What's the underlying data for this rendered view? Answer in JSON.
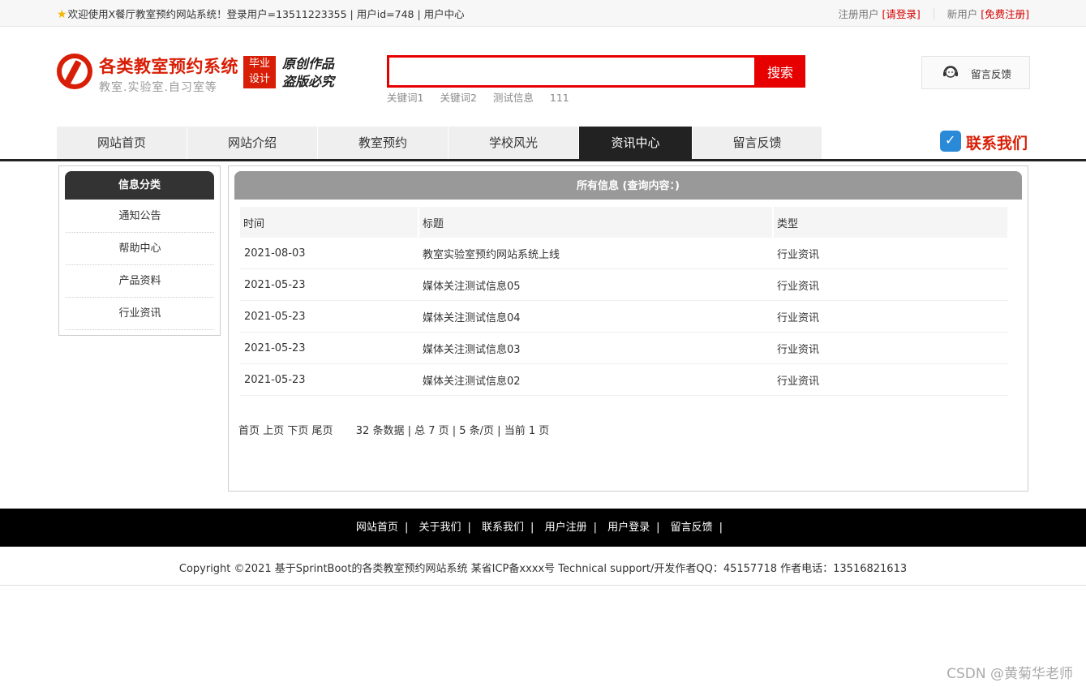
{
  "topbar": {
    "welcome": "欢迎使用X餐厅教室预约网站系统！登录用户=13511223355 | 用户id=748 | 用户中心",
    "reg_user_label": "注册用户",
    "login_link": "[请登录]",
    "new_user_label": "新用户",
    "register_link": "[免费注册]"
  },
  "logo": {
    "title": "各类教室预约系统",
    "subtitle": "教室.实验室.自习室等",
    "badge_line1": "毕业",
    "badge_line2": "设计",
    "seal_line1": "原创作品",
    "seal_line2": "盗版必究",
    "brand_color": "#d81e06"
  },
  "search": {
    "value": "",
    "placeholder": "",
    "button_label": "搜索",
    "hotwords": [
      "关键词1",
      "关键词2",
      "测试信息",
      "111"
    ]
  },
  "feedback_box": {
    "label": "留言反馈",
    "icon": "headset-icon"
  },
  "nav": {
    "items": [
      {
        "label": "网站首页"
      },
      {
        "label": "网站介绍"
      },
      {
        "label": "教室预约"
      },
      {
        "label": "学校风光"
      },
      {
        "label": "资讯中心",
        "active": true
      },
      {
        "label": "留言反馈"
      }
    ],
    "contact_label": "联系我们",
    "contact_icon": "phone-check-icon"
  },
  "sidebar": {
    "title": "信息分类",
    "items": [
      "通知公告",
      "帮助中心",
      "产品资料",
      "行业资讯"
    ]
  },
  "main": {
    "header": "所有信息 (查询内容：)",
    "columns": [
      "时间",
      "标题",
      "类型"
    ],
    "rows": [
      {
        "date": "2021-08-03",
        "title": "教室实验室预约网站系统上线",
        "type": "行业资讯"
      },
      {
        "date": "2021-05-23",
        "title": "媒体关注测试信息05",
        "type": "行业资讯"
      },
      {
        "date": "2021-05-23",
        "title": "媒体关注测试信息04",
        "type": "行业资讯"
      },
      {
        "date": "2021-05-23",
        "title": "媒体关注测试信息03",
        "type": "行业资讯"
      },
      {
        "date": "2021-05-23",
        "title": "媒体关注测试信息02",
        "type": "行业资讯"
      }
    ],
    "pager": {
      "first": "首页",
      "prev": "上页",
      "next": "下页",
      "last": "尾页",
      "summary": "32 条数据 | 总 7 页 | 5 条/页 | 当前 1 页"
    }
  },
  "footer": {
    "links": [
      "网站首页",
      "关于我们",
      "联系我们",
      "用户注册",
      "用户登录",
      "留言反馈"
    ],
    "copyright": "Copyright ©2021 基于SprintBoot的各类教室预约网站系统    某省ICP备xxxx号    Technical support/开发作者QQ：45157718    作者电话：13516821613"
  },
  "watermark": "CSDN @黄菊华老师"
}
